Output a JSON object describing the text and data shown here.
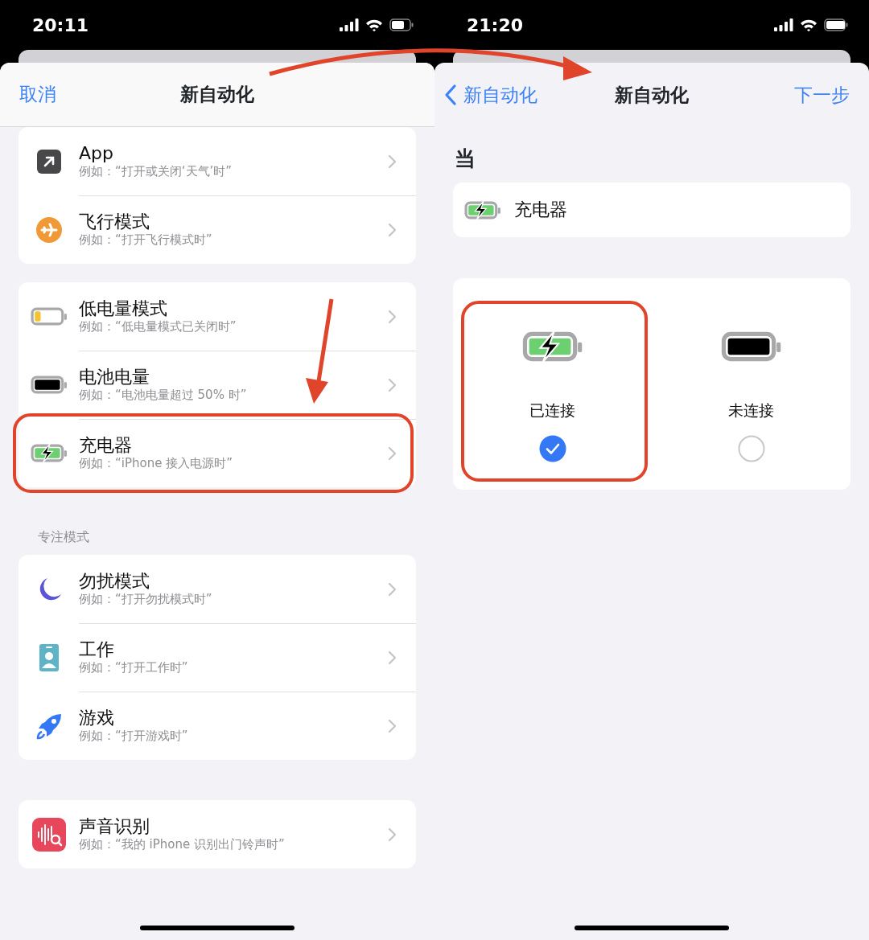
{
  "left": {
    "status_bar": {
      "time": "20:11"
    },
    "nav": {
      "cancel": "取消",
      "title": "新自动化"
    },
    "groups": [
      {
        "rows": [
          {
            "title": "App",
            "subtitle": "例如：“打开或关闭‘天气’时”",
            "highlighted": false
          },
          {
            "title": "飞行模式",
            "subtitle": "例如：“打开飞行模式时”",
            "highlighted": false
          }
        ]
      },
      {
        "rows": [
          {
            "title": "低电量模式",
            "subtitle": "例如：“低电量模式已关闭时”",
            "highlighted": false
          },
          {
            "title": "电池电量",
            "subtitle": "例如：“电池电量超过 50% 时”",
            "highlighted": false
          },
          {
            "title": "充电器",
            "subtitle": "例如：“iPhone 接入电源时”",
            "highlighted": true
          }
        ]
      },
      {
        "header": "专注模式",
        "rows": [
          {
            "title": "勿扰模式",
            "subtitle": "例如：“打开勿扰模式时”",
            "highlighted": false
          },
          {
            "title": "工作",
            "subtitle": "例如：“打开工作时”",
            "highlighted": false
          },
          {
            "title": "游戏",
            "subtitle": "例如：“打开游戏时”",
            "highlighted": false
          }
        ]
      },
      {
        "rows": [
          {
            "title": "声音识别",
            "subtitle": "例如：“我的 iPhone 识别出门铃声时”",
            "highlighted": false
          }
        ]
      }
    ]
  },
  "right": {
    "status_bar": {
      "time": "21:20"
    },
    "nav": {
      "back": "新自动化",
      "title": "新自动化",
      "next": "下一步"
    },
    "section_title": "当",
    "trigger": "充电器",
    "options": [
      {
        "label": "已连接",
        "selected": true,
        "highlighted": true
      },
      {
        "label": "未连接",
        "selected": false,
        "highlighted": false
      }
    ]
  }
}
